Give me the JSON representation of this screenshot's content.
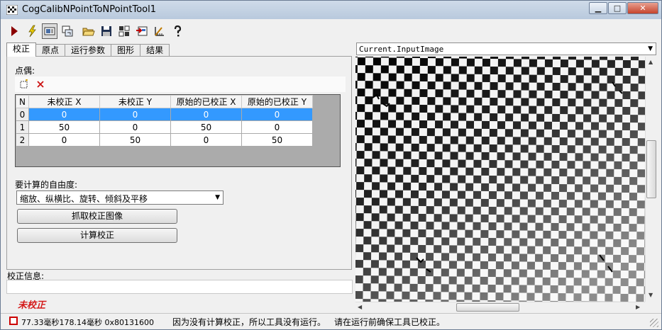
{
  "window": {
    "title": "CogCalibNPointToNPointTool1",
    "minimize_glyph": "▁",
    "maximize_glyph": "□",
    "close_glyph": "✕"
  },
  "toolbar": {
    "icons": [
      "run-icon",
      "electric-icon",
      "display-toggle-icon",
      "floating-window-icon",
      "open-folder-icon",
      "save-icon",
      "reset-icon",
      "import-icon",
      "measure-icon",
      "help-icon"
    ]
  },
  "tabs": [
    "校正",
    "原点",
    "运行参数",
    "图形",
    "结果"
  ],
  "calibration": {
    "pairs_label": "点偶:",
    "grid": {
      "headers": [
        "N",
        "未校正 X",
        "未校正 Y",
        "原始的已校正 X",
        "原始的已校正 Y"
      ],
      "rows": [
        [
          "0",
          "0",
          "0",
          "0",
          "0"
        ],
        [
          "1",
          "50",
          "0",
          "50",
          "0"
        ],
        [
          "2",
          "0",
          "50",
          "0",
          "50"
        ]
      ],
      "selected_row": 0
    },
    "dof_label": "要计算的自由度:",
    "dof_value": "缩放、纵横比、旋转、倾斜及平移",
    "grab_button": "抓取校正图像",
    "compute_button": "计算校正",
    "info_label": "校正信息:",
    "info_text": "",
    "state_text": "未校正"
  },
  "display": {
    "selected_image": "Current.InputImage",
    "vscroll_percent": 44,
    "hscroll_percent": 44
  },
  "status": {
    "time_text": "77.33毫秒178.14毫秒 0x80131600",
    "message": "因为没有计算校正，所以工具没有运行。",
    "hint": "请在运行前确保工具已校正。"
  },
  "colors": {
    "selection": "#3399ff",
    "uncalibrated": "#d41a1a"
  }
}
